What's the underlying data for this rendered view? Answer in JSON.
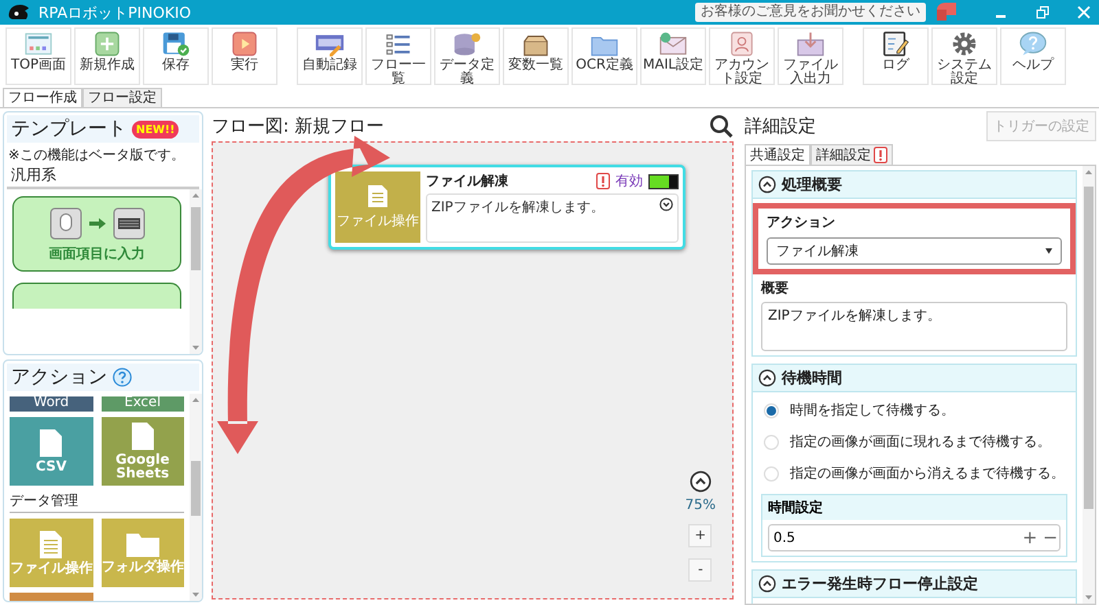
{
  "window": {
    "title": "RPAロボットPINOKIO",
    "feedback": "お客様のご意見をお聞かせください"
  },
  "toolbar": [
    {
      "label": "TOP画面",
      "kind": "top",
      "separated": false
    },
    {
      "label": "新規作成",
      "kind": "new",
      "separated": false
    },
    {
      "label": "保存",
      "kind": "save",
      "separated": false
    },
    {
      "label": "実行",
      "kind": "run",
      "separated": false
    },
    {
      "label": "自動記録",
      "kind": "record",
      "separated": true
    },
    {
      "label": "フロー一覧",
      "kind": "flow-list",
      "separated": false
    },
    {
      "label": "データ定義",
      "kind": "data",
      "separated": false
    },
    {
      "label": "変数一覧",
      "kind": "variables",
      "separated": false
    },
    {
      "label": "OCR定義",
      "kind": "ocr",
      "separated": false
    },
    {
      "label": "MAIL設定",
      "kind": "mail",
      "separated": false
    },
    {
      "label": "アカウント設定",
      "kind": "account",
      "separated": false
    },
    {
      "label": "ファイル入出力",
      "kind": "file-io",
      "separated": false
    },
    {
      "label": "ログ",
      "kind": "log",
      "separated": true
    },
    {
      "label": "システム設定",
      "kind": "system",
      "separated": false
    },
    {
      "label": "ヘルプ",
      "kind": "help",
      "separated": false
    }
  ],
  "main_tabs": [
    {
      "label": "フロー作成",
      "selected": true
    },
    {
      "label": "フロー設定",
      "selected": false
    }
  ],
  "templates": {
    "title": "テンプレート",
    "badge": "NEW!!",
    "note": "※この機能はベータ版です。",
    "category": "汎用系",
    "cards": [
      {
        "kind": "mouse-to-keyboard",
        "label": "画面項目に入力"
      },
      {
        "kind": "partial"
      }
    ]
  },
  "actions": {
    "title": "アクション",
    "tiles": [
      {
        "label": "Word",
        "kind": "strip",
        "color": "#46627c"
      },
      {
        "label": "Excel",
        "kind": "strip",
        "color": "#5e9a66"
      },
      {
        "label": "CSV",
        "kind": "doc",
        "color": "#4aa0a2"
      },
      {
        "label": "Google Sheets",
        "kind": "doc",
        "color": "#93a24c"
      }
    ],
    "category": "データ管理",
    "tiles2": [
      {
        "label": "ファイル操作",
        "kind": "file",
        "color": "#c9b74c"
      },
      {
        "label": "フォルダ操作",
        "kind": "folder",
        "color": "#c9b74c"
      },
      {
        "kind": "partial",
        "color": "#d08c44"
      }
    ]
  },
  "flow": {
    "title": "フロー図: 新規フロー",
    "node": {
      "tile_label": "ファイル操作",
      "title": "ファイル解凍",
      "warning": true,
      "status": "有効",
      "enabled": true,
      "description": "ZIPファイルを解凍します。"
    },
    "zoom": "75%",
    "zoom_in": "+",
    "zoom_out": "-"
  },
  "detail": {
    "title": "詳細設定",
    "trigger_button": {
      "label": "トリガーの設定",
      "disabled": true
    },
    "tabs": [
      {
        "label": "共通設定",
        "selected": true,
        "warning": false
      },
      {
        "label": "詳細設定",
        "selected": false,
        "warning": true
      }
    ],
    "sections": [
      {
        "kind": "summary",
        "title": "処理概要",
        "expanded": true,
        "action_label": "アクション",
        "action_value": "ファイル解凍",
        "highlighted": true,
        "summary_label": "概要",
        "summary_value": "ZIPファイルを解凍します。"
      },
      {
        "kind": "wait",
        "title": "待機時間",
        "expanded": true,
        "options": [
          {
            "label": "時間を指定して待機する。",
            "selected": true
          },
          {
            "label": "指定の画像が画面に現れるまで待機する。",
            "selected": false
          },
          {
            "label": "指定の画像が画面から消えるまで待機する。",
            "selected": false
          }
        ],
        "time_label": "時間設定",
        "time_value": "0.5",
        "increment": "+",
        "decrement": "−"
      },
      {
        "kind": "error",
        "title": "エラー発生時フロー停止設定",
        "expanded": true
      }
    ]
  }
}
